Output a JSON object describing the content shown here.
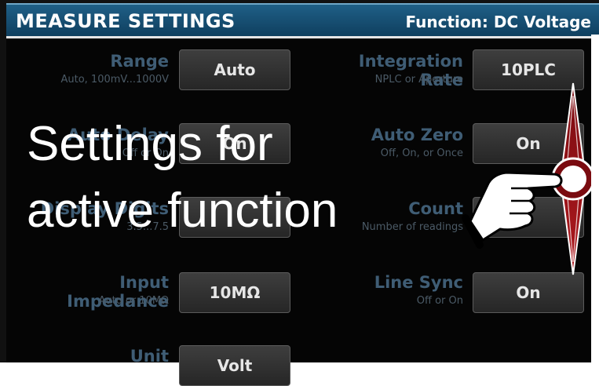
{
  "header": {
    "title": "MEASURE SETTINGS",
    "function": "Function: DC Voltage"
  },
  "settings": {
    "left": [
      {
        "label": "Range",
        "sub": "Auto, 100mV...1000V",
        "value": "Auto"
      },
      {
        "label": "Auto Delay",
        "sub": "Off or On",
        "value": "On"
      },
      {
        "label": "Display Digits",
        "sub": "3.5...7.5",
        "value": ""
      },
      {
        "label": "Input Impedance",
        "sub": "Auto or 10MΩ",
        "value": "10MΩ"
      },
      {
        "label": "Unit",
        "sub": "",
        "value": "Volt"
      }
    ],
    "right": [
      {
        "label": "Integration Rate",
        "sub": "NPLC or Aperture",
        "value": "10PLC"
      },
      {
        "label": "Auto Zero",
        "sub": "Off, On, or Once",
        "value": "On"
      },
      {
        "label": "Count",
        "sub": "Number of readings",
        "value": ""
      },
      {
        "label": "Line Sync",
        "sub": "Off or On",
        "value": "On"
      }
    ]
  },
  "overlay": {
    "line1": "Settings for",
    "line2": "active function"
  },
  "icons": {
    "hand_gesture": "hand-pointer-swipe-icon"
  }
}
